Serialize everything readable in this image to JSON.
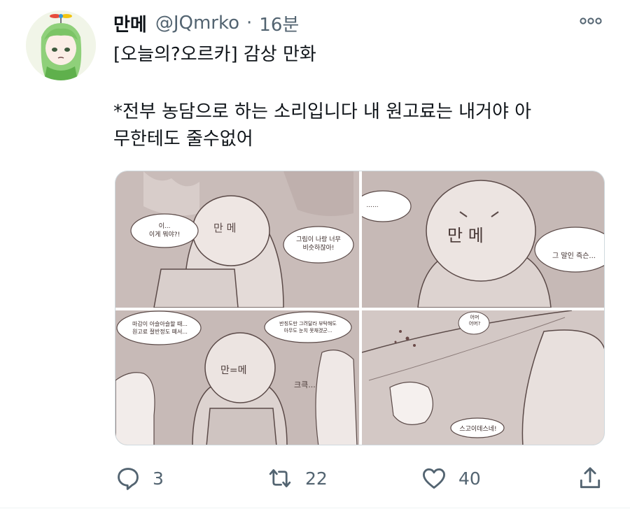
{
  "tweet": {
    "display_name": "만메",
    "handle": "@JQmrko",
    "separator": "·",
    "time": "16분",
    "text_lines": [
      "[오늘의?오르카] 감상 만화",
      "*전부 농담으로 하는 소리입니다 내 원고료는 내거야 아",
      "무한테도 줄수없어"
    ]
  },
  "comic": {
    "panel1": {
      "face": "만 메",
      "bubble_left": "이...\n이게 뭐야?!",
      "bubble_right": "그림이 나랑 너무\n비슷하잖아!"
    },
    "panel2": {
      "face": "만 메",
      "bubble_left": "......",
      "bubble_right": "그 말인 즉슨..."
    },
    "panel3": {
      "face": "만=메",
      "bubble_left": "마감이 아슬아슬할 때...\n원고료 절반정도 떼서...",
      "bubble_right": "반칭도만 그려달라 부탁해도\n아무도 눈치 못채겠군...",
      "laugh": "크큭..."
    },
    "panel4": {
      "bubble_small": "어머\n어머?",
      "bubble_bottom": "스고이데스네!"
    }
  },
  "actions": {
    "reply_count": "3",
    "retweet_count": "22",
    "like_count": "40"
  },
  "colors": {
    "text_primary": "#0f1419",
    "text_secondary": "#536471",
    "panel_bg": "#c6b9b6",
    "ink": "#5b4a48"
  },
  "icons": [
    "more-icon",
    "reply-icon",
    "retweet-icon",
    "like-icon",
    "share-icon"
  ]
}
